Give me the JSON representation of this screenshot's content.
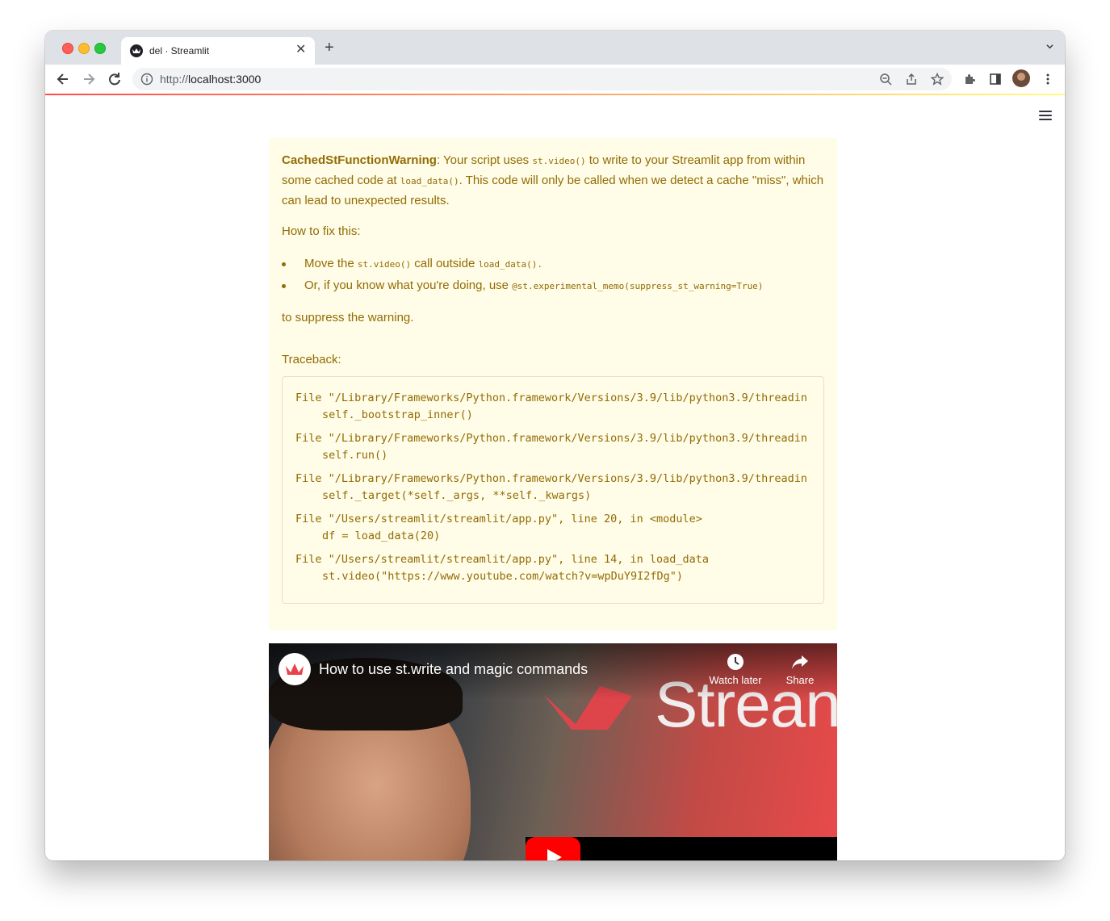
{
  "browser": {
    "tab_title": "del · Streamlit",
    "url_protocol": "http://",
    "url_host": "localhost:3000"
  },
  "warning": {
    "title": "CachedStFunctionWarning",
    "p1_a": ": Your script uses ",
    "p1_code1": "st.video()",
    "p1_b": " to write to your Streamlit app from within",
    "p1_c": "some cached code at ",
    "p1_code2": "load_data()",
    "p1_d": ". This code will only be called when we detect a cache \"miss\", which",
    "p1_e": "can lead to unexpected results.",
    "how_to_fix": "How to fix this:",
    "bullet1_a": "Move the ",
    "bullet1_code1": "st.video()",
    "bullet1_b": " call outside ",
    "bullet1_code2": "load_data().",
    "bullet2_a": "Or, if you know what you're doing, use ",
    "bullet2_code": "@st.experimental_memo(suppress_st_warning=True)",
    "suppress": "to suppress the warning.",
    "traceback_label": "Traceback:",
    "traceback": [
      "File \"/Library/Frameworks/Python.framework/Versions/3.9/lib/python3.9/threadin",
      "self._bootstrap_inner()",
      "File \"/Library/Frameworks/Python.framework/Versions/3.9/lib/python3.9/threadin",
      "self.run()",
      "File \"/Library/Frameworks/Python.framework/Versions/3.9/lib/python3.9/threadin",
      "self._target(*self._args, **self._kwargs)",
      "File \"/Users/streamlit/streamlit/app.py\", line 20, in <module>",
      "df = load_data(20)",
      "File \"/Users/streamlit/streamlit/app.py\", line 14, in load_data",
      "st.video(\"https://www.youtube.com/watch?v=wpDuY9I2fDg\")"
    ]
  },
  "video": {
    "title": "How to use st.write and magic commands",
    "watch_later": "Watch later",
    "share": "Share",
    "overlay_word": "Strean"
  },
  "colors": {
    "warning_bg": "#fffce7",
    "warning_text": "#926c05",
    "streamlit_red": "#ff4b4b"
  }
}
